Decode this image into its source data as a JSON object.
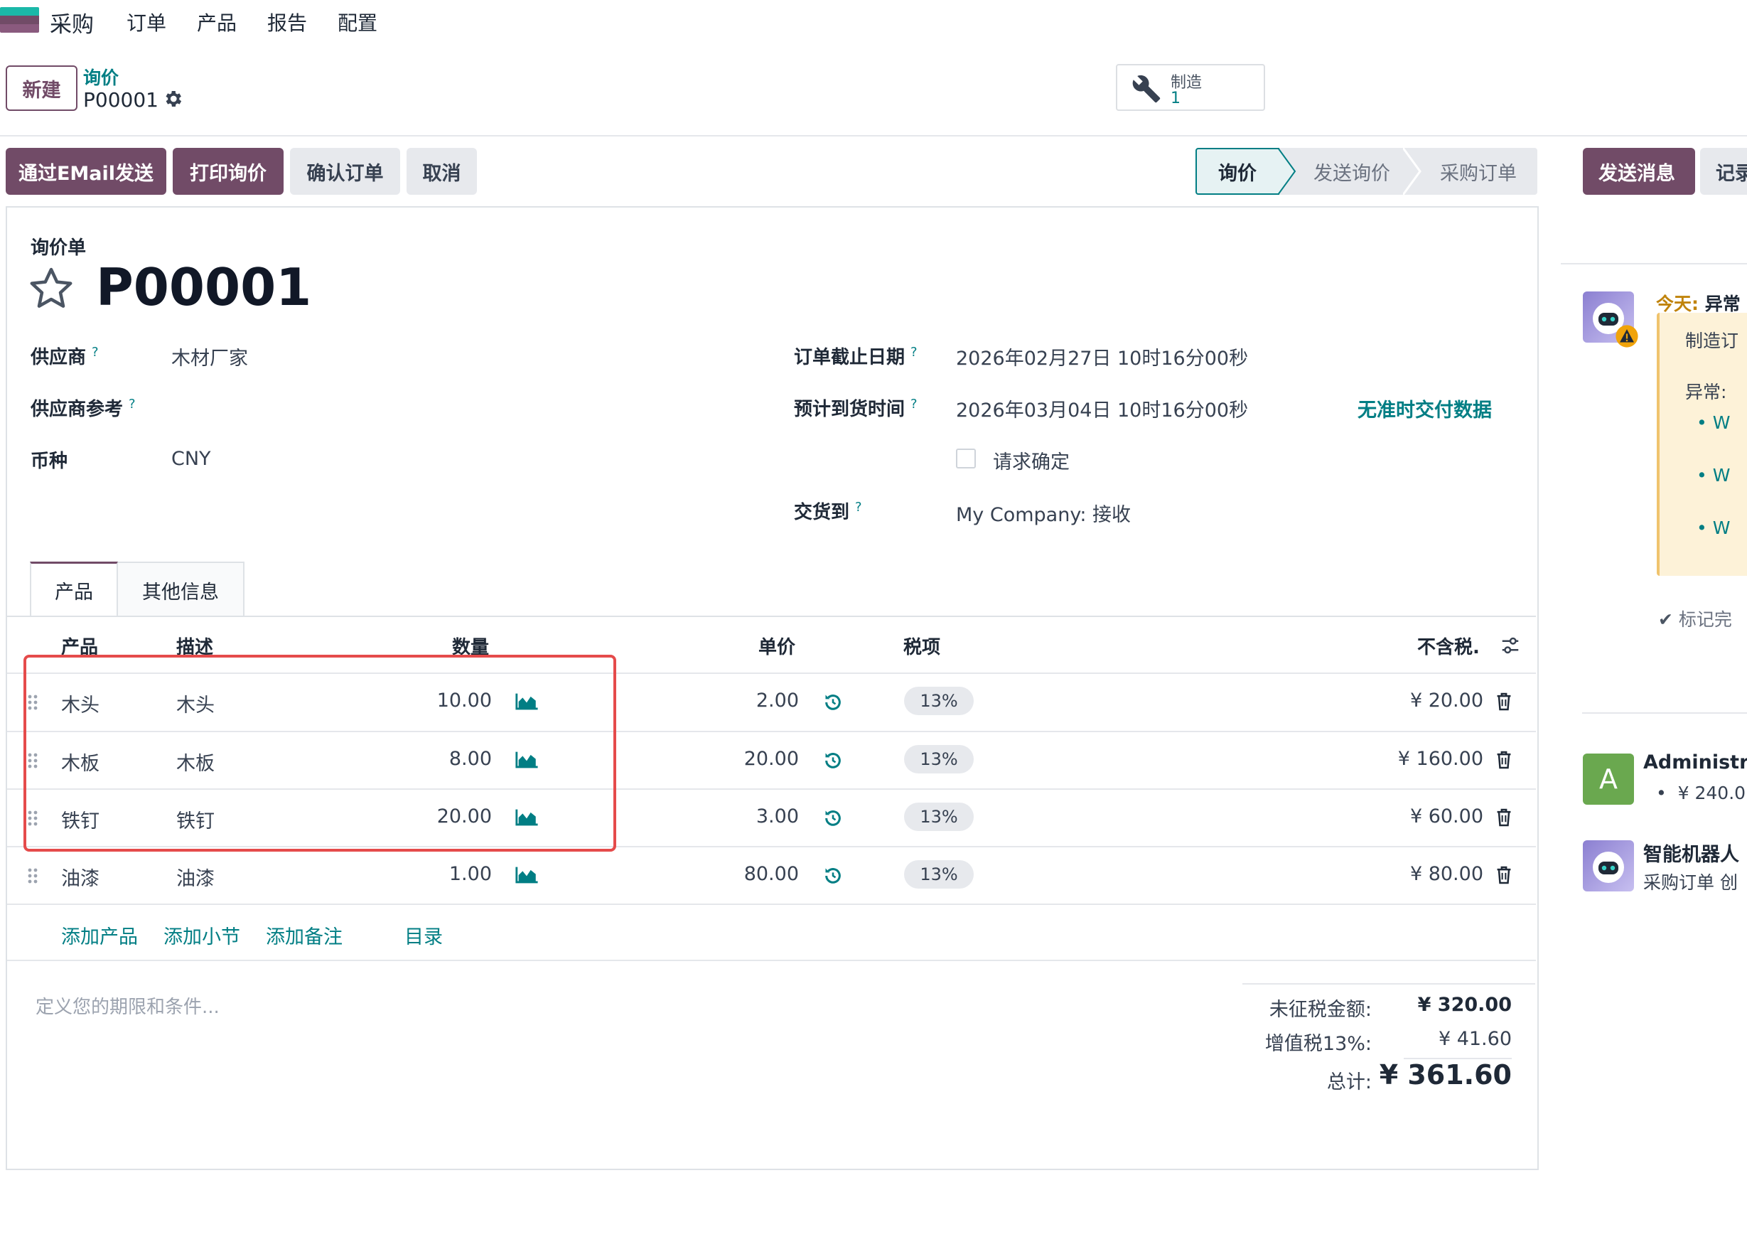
{
  "navbar": {
    "app_name": "采购",
    "menu": [
      "订单",
      "产品",
      "报告",
      "配置"
    ]
  },
  "control_panel": {
    "new_button": "新建",
    "breadcrumb_parent": "询价",
    "breadcrumb_current": "P00001",
    "smart_button": {
      "label": "制造",
      "value": "1",
      "icon": "wrench-icon"
    }
  },
  "actions": {
    "send_email": "通过EMail发送",
    "print_rfq": "打印询价",
    "confirm_order": "确认订单",
    "cancel": "取消"
  },
  "status_stages": [
    "询价",
    "发送询价",
    "采购订单"
  ],
  "status_active": "询价",
  "form": {
    "doc_type": "询价单",
    "doc_number": "P00001",
    "left_fields": [
      {
        "label": "供应商",
        "help": "?",
        "value": "木材厂家"
      },
      {
        "label": "供应商参考",
        "help": "?",
        "value": ""
      },
      {
        "label": "币种",
        "help": "",
        "value": "CNY"
      }
    ],
    "right_fields": [
      {
        "label": "订单截止日期",
        "help": "?",
        "value": "2026年02月27日 10时16分00秒"
      },
      {
        "label": "预计到货时间",
        "help": "?",
        "value": "2026年03月04日 10时16分00秒"
      },
      {
        "label": "交货到",
        "help": "?",
        "value": "My Company: 接收"
      }
    ],
    "on_time_link": "无准时交付数据",
    "request_confirm_label": "请求确定",
    "request_confirm_checked": false
  },
  "tabs": [
    "产品",
    "其他信息"
  ],
  "table": {
    "headers": {
      "product": "产品",
      "description": "描述",
      "quantity": "数量",
      "unit_price": "单价",
      "taxes": "税项",
      "subtotal": "不含税."
    },
    "rows": [
      {
        "product": "木头",
        "description": "木头",
        "quantity": "10.00",
        "unit_price": "2.00",
        "tax": "13%",
        "subtotal": "¥ 20.00"
      },
      {
        "product": "木板",
        "description": "木板",
        "quantity": "8.00",
        "unit_price": "20.00",
        "tax": "13%",
        "subtotal": "¥ 160.00"
      },
      {
        "product": "铁钉",
        "description": "铁钉",
        "quantity": "20.00",
        "unit_price": "3.00",
        "tax": "13%",
        "subtotal": "¥ 60.00"
      },
      {
        "product": "油漆",
        "description": "油漆",
        "quantity": "1.00",
        "unit_price": "80.00",
        "tax": "13%",
        "subtotal": "¥ 80.00"
      }
    ],
    "add_product": "添加产品",
    "add_section": "添加小节",
    "add_note": "添加备注",
    "catalog": "目录"
  },
  "terms_placeholder": "定义您的期限和条件...",
  "totals": {
    "untaxed_label": "未征税金额:",
    "untaxed_value": "¥ 320.00",
    "vat_label": "增值税13%:",
    "vat_value": "¥ 41.60",
    "total_label": "总计:",
    "total_value": "¥ 361.60"
  },
  "chatter": {
    "send_message": "发送消息",
    "log_note": "记录",
    "today_label": "今天:",
    "today_title": "异常",
    "activity_text": "制造订",
    "exception_label": "异常:",
    "bullets": [
      "W",
      "W",
      "W"
    ],
    "mark_done": "标记完",
    "messages": [
      {
        "author": "Administra",
        "avatar_letter": "A",
        "body": "¥ 240.0"
      },
      {
        "author": "智能机器人",
        "body": "采购订单 创"
      }
    ]
  },
  "colors": {
    "brand": "#714B67",
    "accent": "#017e84",
    "highlight": "#e54b4b"
  }
}
